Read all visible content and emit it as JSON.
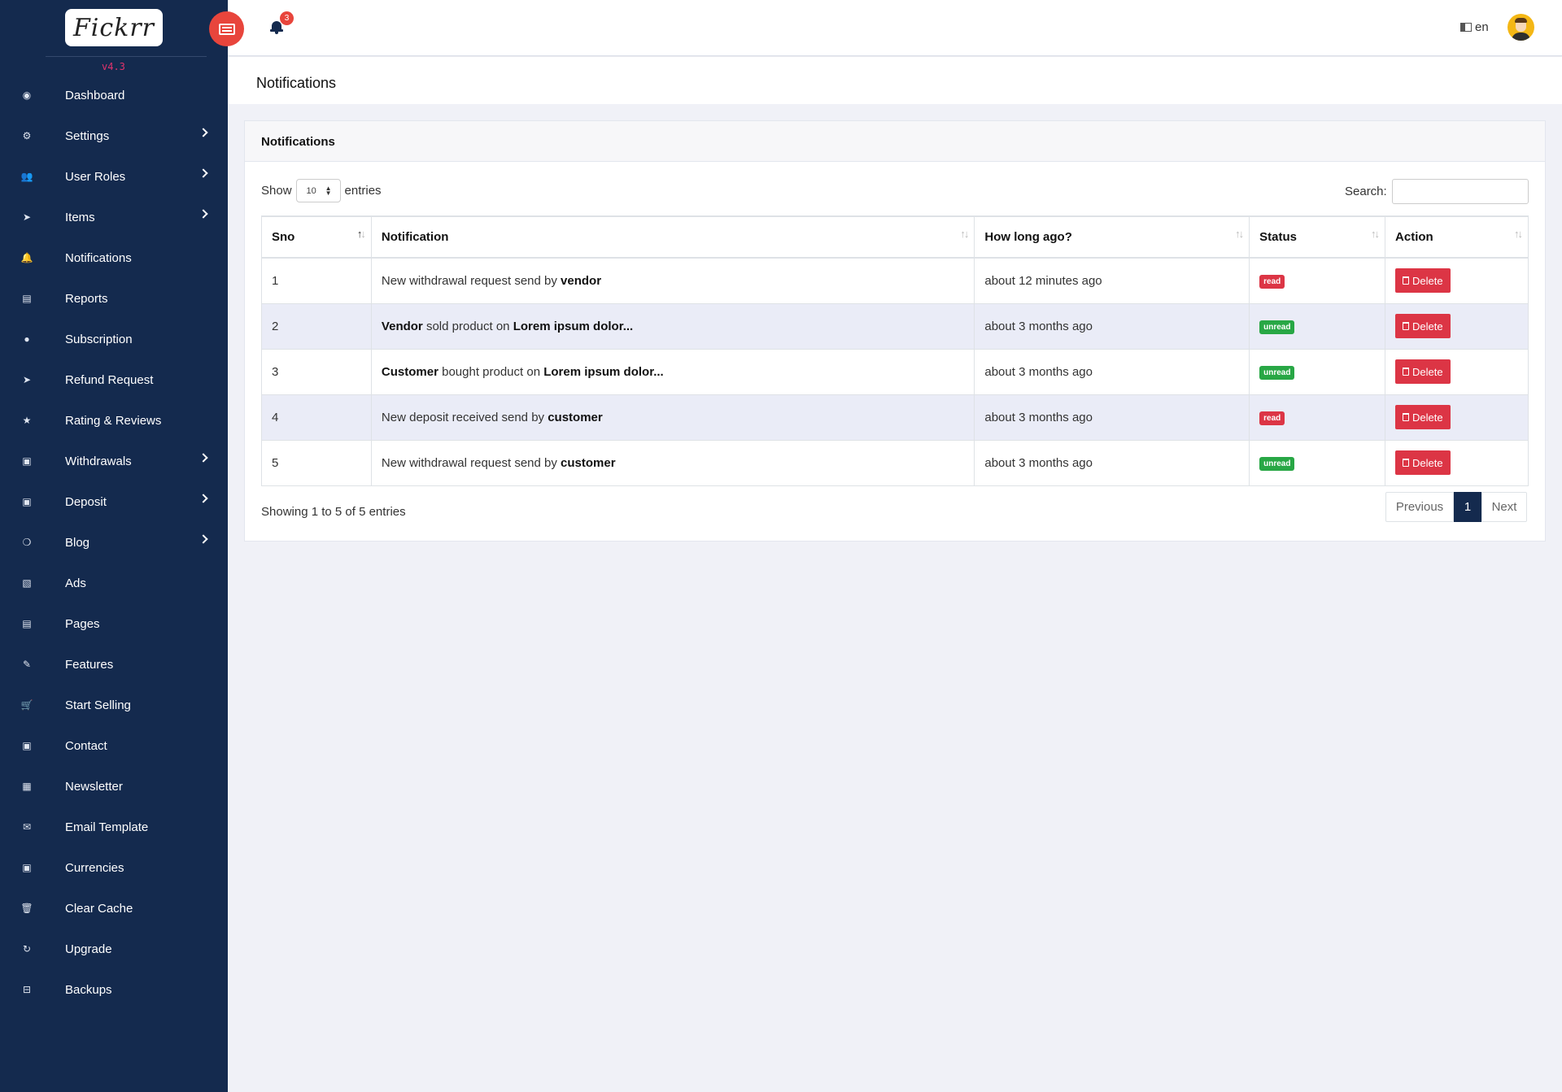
{
  "sidebar": {
    "logo_text": "Fickrr",
    "version": "v4.3",
    "items": [
      {
        "label": "Dashboard",
        "icon": "dashboard-icon",
        "glyph": "◉",
        "has_children": false
      },
      {
        "label": "Settings",
        "icon": "gears-icon",
        "glyph": "⚙",
        "has_children": true
      },
      {
        "label": "User Roles",
        "icon": "users-icon",
        "glyph": "👥",
        "has_children": true
      },
      {
        "label": "Items",
        "icon": "paper-plane-icon",
        "glyph": "➤",
        "has_children": true
      },
      {
        "label": "Notifications",
        "icon": "bell-icon",
        "glyph": "🔔",
        "has_children": false
      },
      {
        "label": "Reports",
        "icon": "file-icon",
        "glyph": "▤",
        "has_children": false
      },
      {
        "label": "Subscription",
        "icon": "user-icon",
        "glyph": "●",
        "has_children": false
      },
      {
        "label": "Refund Request",
        "icon": "send-icon",
        "glyph": "➤",
        "has_children": false
      },
      {
        "label": "Rating & Reviews",
        "icon": "star-icon",
        "glyph": "★",
        "has_children": false
      },
      {
        "label": "Withdrawals",
        "icon": "money-icon",
        "glyph": "▣",
        "has_children": true
      },
      {
        "label": "Deposit",
        "icon": "money-icon",
        "glyph": "▣",
        "has_children": true
      },
      {
        "label": "Blog",
        "icon": "comments-icon",
        "glyph": "❍",
        "has_children": true
      },
      {
        "label": "Ads",
        "icon": "image-file-icon",
        "glyph": "▧",
        "has_children": false
      },
      {
        "label": "Pages",
        "icon": "document-icon",
        "glyph": "▤",
        "has_children": false
      },
      {
        "label": "Features",
        "icon": "magic-icon",
        "glyph": "✎",
        "has_children": false
      },
      {
        "label": "Start Selling",
        "icon": "cart-icon",
        "glyph": "🛒",
        "has_children": false
      },
      {
        "label": "Contact",
        "icon": "address-book-icon",
        "glyph": "▣",
        "has_children": false
      },
      {
        "label": "Newsletter",
        "icon": "newspaper-icon",
        "glyph": "▦",
        "has_children": false
      },
      {
        "label": "Email Template",
        "icon": "envelope-icon",
        "glyph": "✉",
        "has_children": false
      },
      {
        "label": "Currencies",
        "icon": "money-icon",
        "glyph": "▣",
        "has_children": false
      },
      {
        "label": "Clear Cache",
        "icon": "trash-icon",
        "glyph": "🗑",
        "has_children": false
      },
      {
        "label": "Upgrade",
        "icon": "refresh-icon",
        "glyph": "↻",
        "has_children": false
      },
      {
        "label": "Backups",
        "icon": "hdd-icon",
        "glyph": "⊟",
        "has_children": false
      }
    ]
  },
  "topbar": {
    "notification_count": "3",
    "language": "en"
  },
  "page": {
    "title": "Notifications",
    "card_title": "Notifications"
  },
  "table_controls": {
    "show_label": "Show",
    "entries_label": "entries",
    "page_size": "10",
    "search_label": "Search:",
    "search_value": ""
  },
  "table": {
    "columns": [
      "Sno",
      "Notification",
      "How long ago?",
      "Status",
      "Action"
    ],
    "rows": [
      {
        "sno": "1",
        "notification": [
          {
            "t": "New withdrawal request send by ",
            "b": false
          },
          {
            "t": "vendor",
            "b": true
          }
        ],
        "ago": "about 12 minutes ago",
        "status": "read",
        "action": "Delete"
      },
      {
        "sno": "2",
        "notification": [
          {
            "t": "Vendor",
            "b": true
          },
          {
            "t": " sold product on ",
            "b": false
          },
          {
            "t": "Lorem ipsum dolor...",
            "b": true
          }
        ],
        "ago": "about 3 months ago",
        "status": "unread",
        "action": "Delete"
      },
      {
        "sno": "3",
        "notification": [
          {
            "t": "Customer",
            "b": true
          },
          {
            "t": " bought product on ",
            "b": false
          },
          {
            "t": "Lorem ipsum dolor...",
            "b": true
          }
        ],
        "ago": "about 3 months ago",
        "status": "unread",
        "action": "Delete"
      },
      {
        "sno": "4",
        "notification": [
          {
            "t": "New deposit received send by ",
            "b": false
          },
          {
            "t": "customer",
            "b": true
          }
        ],
        "ago": "about 3 months ago",
        "status": "read",
        "action": "Delete"
      },
      {
        "sno": "5",
        "notification": [
          {
            "t": "New withdrawal request send by ",
            "b": false
          },
          {
            "t": "customer",
            "b": true
          }
        ],
        "ago": "about 3 months ago",
        "status": "unread",
        "action": "Delete"
      }
    ]
  },
  "footer": {
    "info": "Showing 1 to 5 of 5 entries",
    "prev_label": "Previous",
    "current_page": "1",
    "next_label": "Next"
  },
  "colors": {
    "sidebar_bg": "#142a4e",
    "accent_red": "#dc3545",
    "status_read": "#dc3545",
    "status_unread": "#28a745",
    "toggle_button": "#e8453c"
  }
}
